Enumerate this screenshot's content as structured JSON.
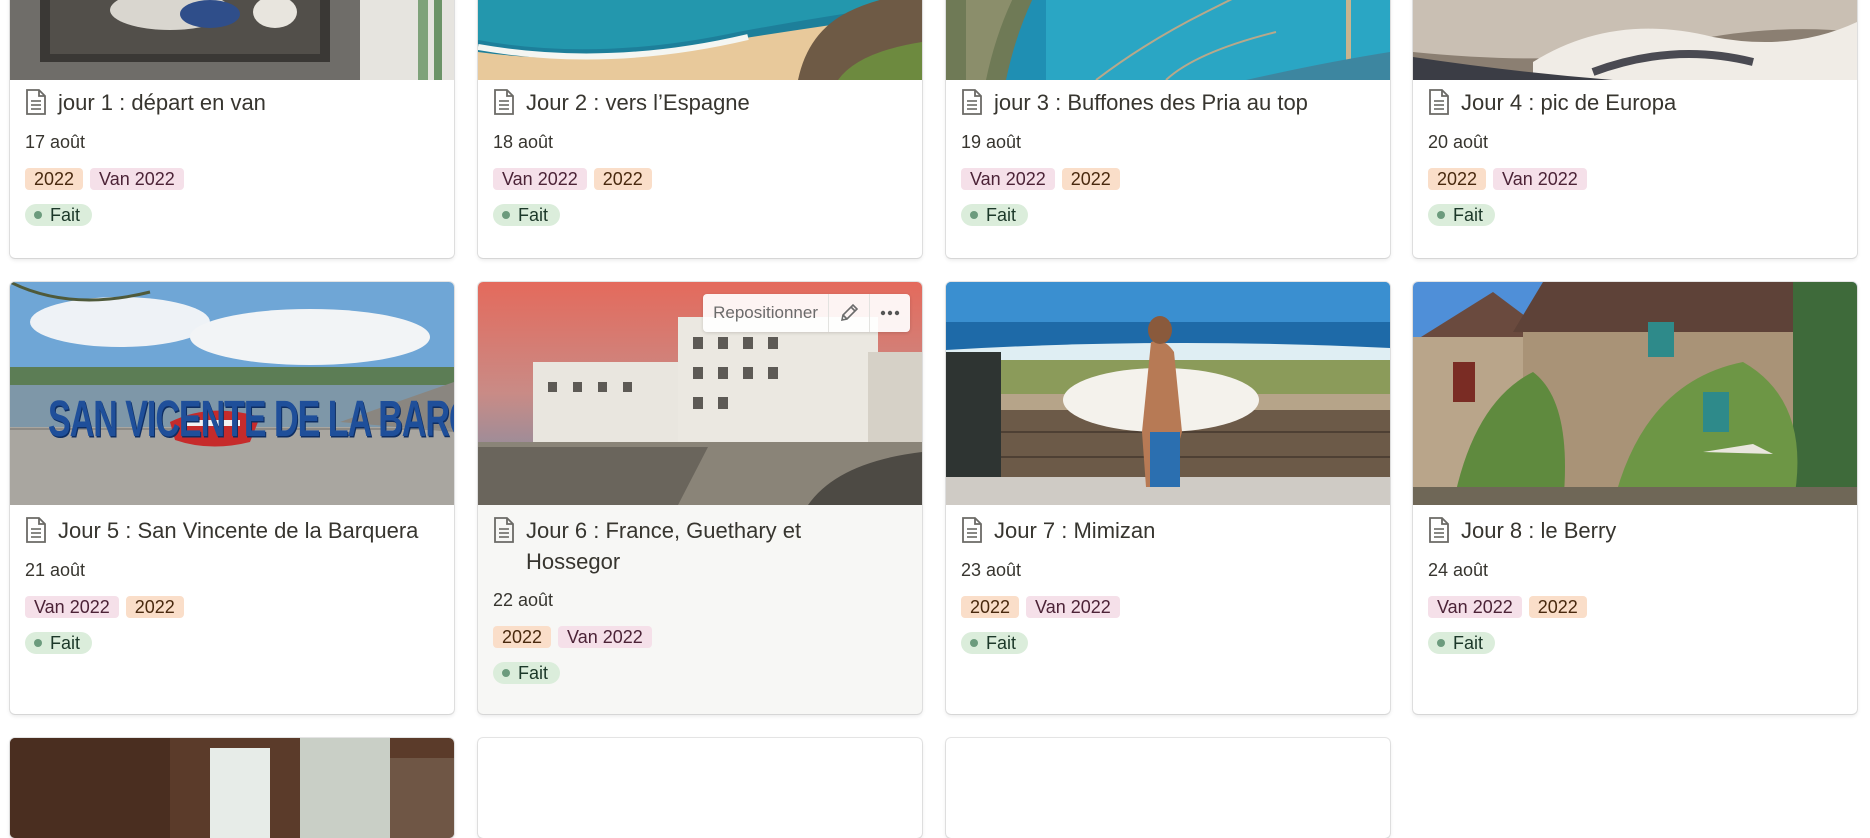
{
  "cards": [
    {
      "title": "jour 1 : départ en van",
      "date": "17 août",
      "tags": [
        "2022",
        "Van 2022"
      ],
      "status": "Fait"
    },
    {
      "title": "Jour 2 : vers l’Espagne",
      "date": "18 août",
      "tags": [
        "Van 2022",
        "2022"
      ],
      "status": "Fait"
    },
    {
      "title": "jour 3 : Buffones des Pria au top",
      "date": "19 août",
      "tags": [
        "Van 2022",
        "2022"
      ],
      "status": "Fait"
    },
    {
      "title": "Jour 4 : pic de Europa",
      "date": "20 août",
      "tags": [
        "2022",
        "Van 2022"
      ],
      "status": "Fait"
    },
    {
      "title": "Jour 5 : San Vincente de la Barquera",
      "date": "21 août",
      "tags": [
        "Van 2022",
        "2022"
      ],
      "status": "Fait"
    },
    {
      "title": "Jour 6 : France, Guethary et Hossegor",
      "date": "22 août",
      "tags": [
        "2022",
        "Van 2022"
      ],
      "status": "Fait"
    },
    {
      "title": "Jour 7 : Mimizan",
      "date": "23 août",
      "tags": [
        "2022",
        "Van 2022"
      ],
      "status": "Fait"
    },
    {
      "title": "Jour 8 : le Berry",
      "date": "24 août",
      "tags": [
        "Van 2022",
        "2022"
      ],
      "status": "Fait"
    }
  ],
  "hover_toolbar": {
    "reposition_label": "Repositionner",
    "edit_icon": "pencil-icon",
    "more_icon": "more-horizontal-icon"
  },
  "cover_sign_text": "SAN VICENTE DE LA BARQUERA",
  "colors": {
    "tag_2022_bg": "#fadec9",
    "tag_van_bg": "#f5e0e9",
    "status_bg": "#dbeddb",
    "status_dot": "#6c9b7d"
  }
}
